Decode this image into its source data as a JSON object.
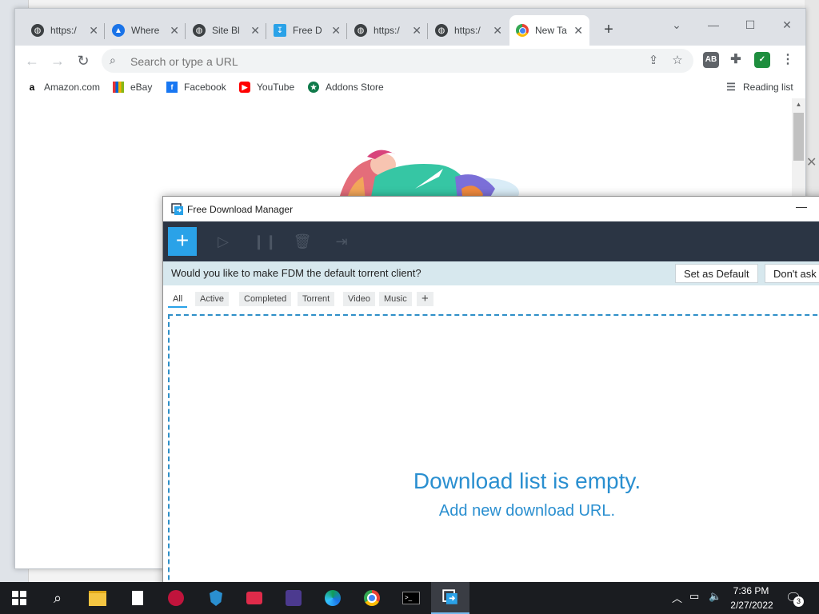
{
  "browser": {
    "tabs": [
      {
        "title": "https:/",
        "favicon": "globe-icon"
      },
      {
        "title": "Where",
        "favicon": "alert-triangle-icon"
      },
      {
        "title": "Site Bl",
        "favicon": "globe-icon"
      },
      {
        "title": "Free D",
        "favicon": "fdm-icon"
      },
      {
        "title": "https:/",
        "favicon": "globe-icon"
      },
      {
        "title": "https:/",
        "favicon": "globe-icon"
      },
      {
        "title": "New Ta",
        "favicon": "chrome-icon",
        "active": true
      }
    ],
    "new_tab_label": "+",
    "omnibox_placeholder": "Search or type a URL",
    "bookmarks": [
      {
        "label": "Amazon.com",
        "icon": "amazon-icon"
      },
      {
        "label": "eBay",
        "icon": "ebay-icon"
      },
      {
        "label": "Facebook",
        "icon": "facebook-icon"
      },
      {
        "label": "YouTube",
        "icon": "youtube-icon"
      },
      {
        "label": "Addons Store",
        "icon": "addons-icon"
      }
    ],
    "reading_list": "Reading list"
  },
  "fdm": {
    "title": "Free Download Manager",
    "banner_text": "Would you like to make FDM the default torrent client?",
    "set_default": "Set as Default",
    "dont_ask": "Don't ask",
    "filters": [
      "All",
      "Active",
      "Completed",
      "Torrent",
      "Video",
      "Music"
    ],
    "add_filter": "+",
    "empty_title": "Download list is empty.",
    "empty_subtitle": "Add new download URL."
  },
  "taskbar": {
    "time": "7:36 PM",
    "date": "2/27/2022",
    "notifications": "3"
  },
  "colors": {
    "fdm_accent": "#2aa2e8",
    "fdm_toolbar": "#2b3544",
    "banner": "#d7e8ee",
    "taskbar": "#1a1c20"
  }
}
